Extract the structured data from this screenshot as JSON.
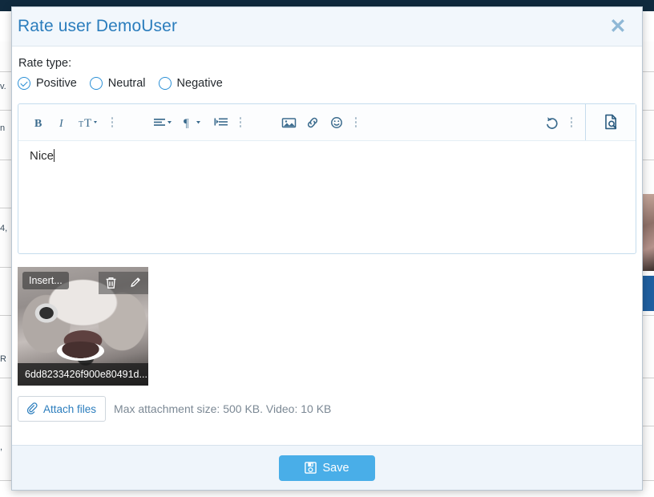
{
  "dialog": {
    "title": "Rate user DemoUser",
    "close_icon": "close-icon",
    "rate_type_label": "Rate type:",
    "rate_options": [
      {
        "label": "Positive",
        "selected": true
      },
      {
        "label": "Neutral",
        "selected": false
      },
      {
        "label": "Negative",
        "selected": false
      }
    ]
  },
  "editor": {
    "content": "Nice",
    "toolbar": {
      "bold": "B",
      "italic": "I",
      "font_size": "font-size-icon",
      "more_text": "more-options-icon",
      "align": "align-left-icon",
      "paragraph": "paragraph-icon",
      "indent": "indent-icon",
      "more_paragraph": "more-options-icon",
      "image": "image-icon",
      "link": "link-icon",
      "emoji": "emoji-icon",
      "more_insert": "more-options-icon",
      "undo": "undo-icon",
      "more_history": "more-options-icon",
      "preview": "preview-source-icon"
    }
  },
  "attachment": {
    "insert_label": "Insert...",
    "delete_icon": "trash-icon",
    "edit_icon": "pencil-icon",
    "filename": "6dd8233426f900e80491d..."
  },
  "attach": {
    "button_label": "Attach files",
    "button_icon": "paperclip-icon",
    "hint": "Max attachment size: 500 KB. Video: 10 KB"
  },
  "footer": {
    "save_label": "Save",
    "save_icon": "floppy-disk-icon"
  },
  "colors": {
    "title": "#2b7dbd",
    "accent": "#49aee8",
    "radio": "#2a8fd6",
    "backdrop": "#0f2a3d",
    "footer_bg": "#eff5fb"
  },
  "background": {
    "fragments": [
      "v.",
      "n",
      "4,",
      "R",
      ","
    ]
  }
}
